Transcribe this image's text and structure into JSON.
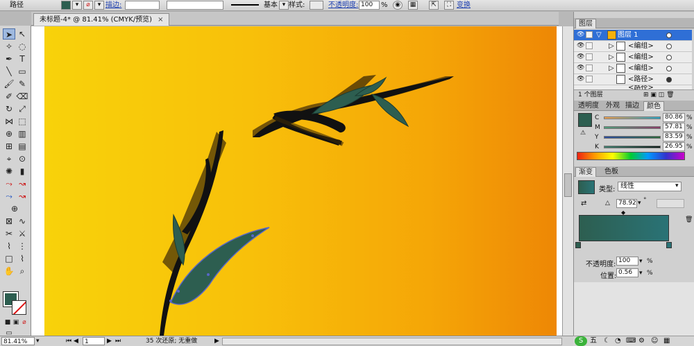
{
  "control_bar": {
    "object_type": "路径",
    "stroke_label": "描边:",
    "stroke_weight_label": "基本",
    "style_label": "样式:",
    "opacity_label": "不透明度:",
    "opacity_value": "100",
    "opacity_unit": "%",
    "transform_label": "变换"
  },
  "document": {
    "tab_title": "未标题-4* @ 81.41% (CMYK/预览)",
    "close_glyph": "×"
  },
  "status_bar": {
    "zoom": "81.41%",
    "artboard": "1",
    "history": "35 次还原; 无重做"
  },
  "layers_panel": {
    "tab": "图层",
    "rows": [
      {
        "name": "图层 1",
        "highlighted": true
      },
      {
        "name": "<编组>"
      },
      {
        "name": "<编组>"
      },
      {
        "name": "<编组>"
      },
      {
        "name": "<路径>"
      },
      {
        "name": "<路径>"
      }
    ],
    "footer": "1 个图层"
  },
  "color_panel": {
    "tabs": [
      "透明度",
      "外观",
      "描边",
      "颜色"
    ],
    "active_tab": "颜色",
    "channels": [
      {
        "label": "C",
        "value": "80.86"
      },
      {
        "label": "M",
        "value": "57.81"
      },
      {
        "label": "Y",
        "value": "83.59"
      },
      {
        "label": "K",
        "value": "26.95"
      }
    ],
    "swatch_color": "#2d5e50"
  },
  "gradient_panel": {
    "tabs": [
      "渐变",
      "色板"
    ],
    "active_tab": "渐变",
    "type_label": "类型:",
    "type_value": "线性",
    "angle_value": "78.92",
    "angle_unit": "°",
    "opacity_label": "不透明度:",
    "opacity_value": "100",
    "location_label": "位置:",
    "location_value": "0.56",
    "percent": "%",
    "gradient_start": "#2d5e50",
    "gradient_end": "#2a7376"
  },
  "taskbar": {
    "ime_label": "五"
  }
}
